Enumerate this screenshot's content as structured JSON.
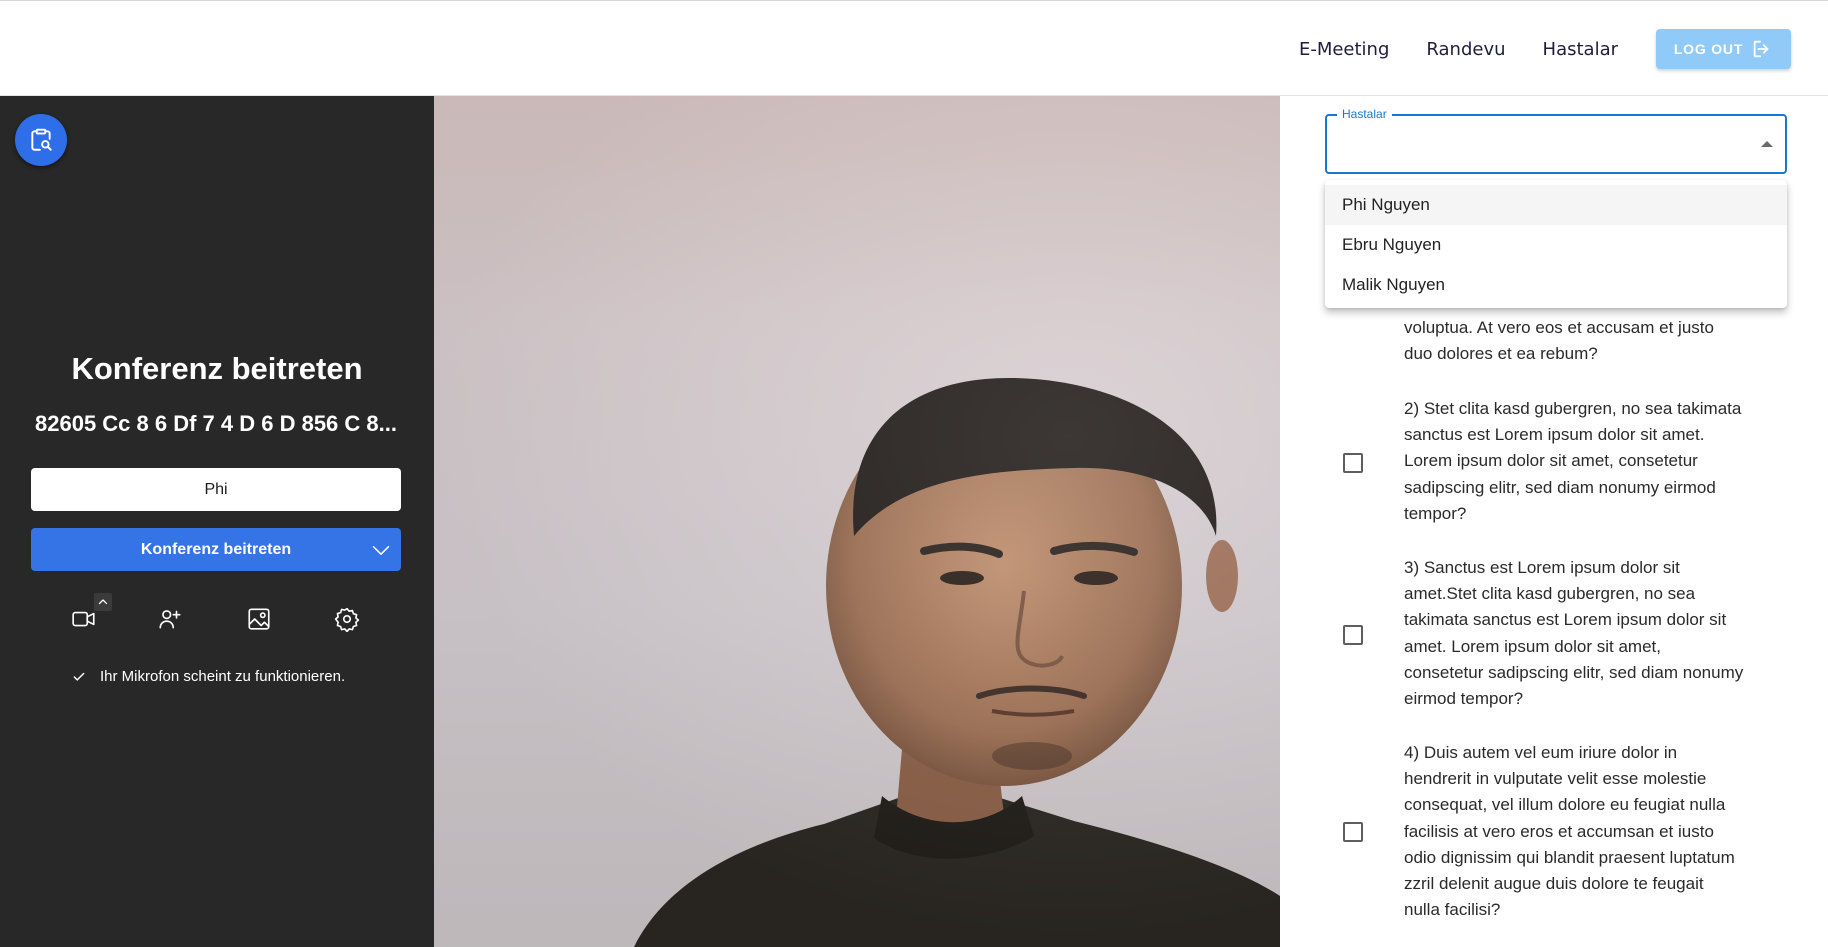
{
  "nav": {
    "items": [
      "E-Meeting",
      "Randevu",
      "Hastalar"
    ],
    "logout_label": "LOG OUT"
  },
  "prejoin": {
    "title": "Konferenz beitreten",
    "room_id": "82605 Cc 8 6 Df 7 4 D 6 D 856 C 8...",
    "name_value": "Phi",
    "join_button_label": "Konferenz beitreten",
    "mic_status": "Ihr Mikrofon scheint zu funktionieren.",
    "accent_color": "#3474e6"
  },
  "patients": {
    "select_label": "Hastalar",
    "options": [
      "Phi Nguyen",
      "Ebru Nguyen",
      "Malik Nguyen"
    ]
  },
  "questions": [
    {
      "text": "voluptua. At vero eos et accusam et justo duo dolores et ea rebum?"
    },
    {
      "text": "2) Stet clita kasd gubergren, no sea takimata sanctus est Lorem ipsum dolor sit amet. Lorem ipsum dolor sit amet, consetetur sadipscing elitr, sed diam nonumy eirmod tempor?"
    },
    {
      "text": "3) Sanctus est Lorem ipsum dolor sit amet.Stet clita kasd gubergren, no sea takimata sanctus est Lorem ipsum dolor sit amet. Lorem ipsum dolor sit amet, consetetur sadipscing elitr, sed diam nonumy eirmod tempor?"
    },
    {
      "text": "4) Duis autem vel eum iriure dolor in hendrerit in vulputate velit esse molestie consequat, vel illum dolore eu feugiat nulla facilisis at vero eros et accumsan et iusto odio dignissim qui blandit praesent luptatum zzril delenit augue duis dolore te feugait nulla facilisi?"
    }
  ]
}
